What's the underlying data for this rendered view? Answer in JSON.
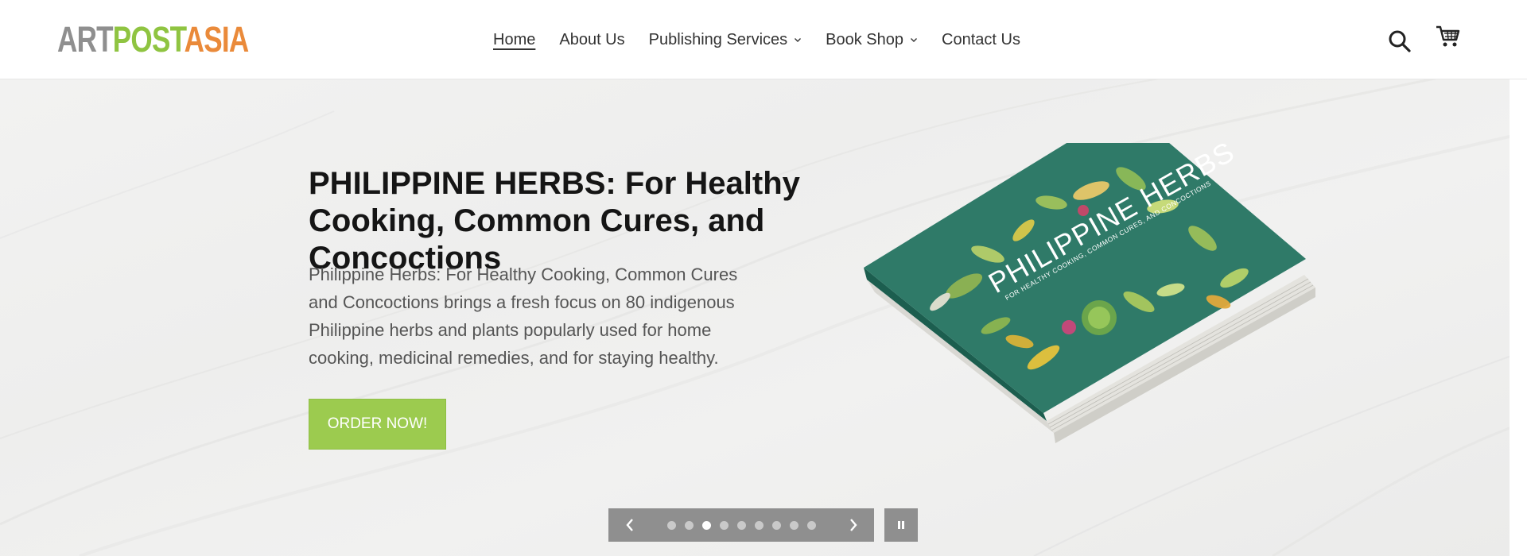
{
  "brand": {
    "logo_part_1": "ART",
    "logo_part_2": "POST",
    "logo_part_3": "ASIA",
    "colors": {
      "grey": "#8f8f8f",
      "green": "#8fc441",
      "orange": "#ea8a3a"
    }
  },
  "nav": {
    "items": [
      {
        "label": "Home",
        "active": true
      },
      {
        "label": "About Us"
      },
      {
        "label": "Publishing Services",
        "has_dropdown": true
      },
      {
        "label": "Book Shop",
        "has_dropdown": true
      },
      {
        "label": "Contact Us"
      }
    ]
  },
  "header_icons": {
    "search": "search-icon",
    "cart": "cart-icon"
  },
  "hero": {
    "title": "PHILIPPINE HERBS: For Healthy Cooking, Common Cures, and Concoctions",
    "description": "Philippine Herbs: For Healthy Cooking, Common Cures and Concoctions brings a fresh focus on 80 indigenous Philippine herbs and plants popularly used for home cooking, medicinal remedies, and for staying healthy.",
    "cta_label": "ORDER NOW!",
    "cta_color": "#9ccb4f",
    "book_cover_title": "PHILIPPINE HERBS",
    "book_cover_subtitle": "FOR HEALTHY COOKING, COMMON CURES, AND CONCOCTIONS",
    "book_cover_color": "#2f7a68"
  },
  "slider": {
    "slide_count": 9,
    "active_slide": 3,
    "prev_icon": "chevron-left-icon",
    "next_icon": "chevron-right-icon",
    "pause_icon": "pause-icon"
  }
}
